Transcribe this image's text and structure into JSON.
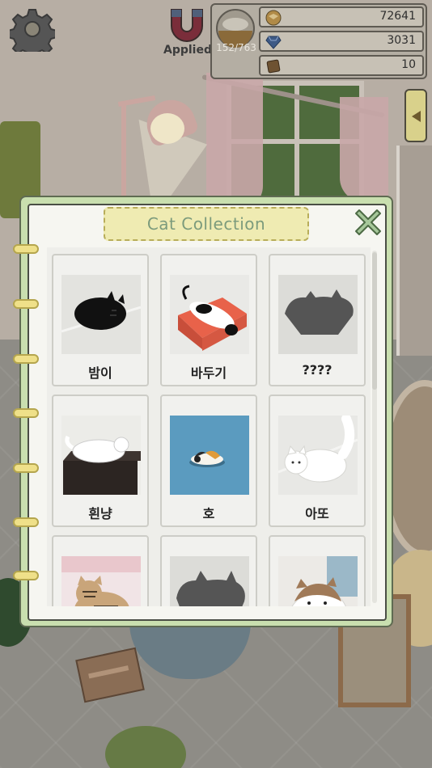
{
  "hud": {
    "magnet_status": "Applied",
    "meter_text": "152/763",
    "resources": [
      {
        "icon": "coin-icon",
        "value": "72641"
      },
      {
        "icon": "gem-icon",
        "value": "3031"
      },
      {
        "icon": "ticket-icon",
        "value": "10"
      }
    ]
  },
  "collection": {
    "title": "Cat Collection",
    "cats": [
      {
        "name": "밤이",
        "discovered": true,
        "photo": "black-cat-sleeping"
      },
      {
        "name": "바두기",
        "discovered": true,
        "photo": "tuxedo-cat-on-cushion"
      },
      {
        "name": "????",
        "discovered": false,
        "photo": "silhouette"
      },
      {
        "name": "흰냥",
        "discovered": true,
        "photo": "white-cat-on-cabinet"
      },
      {
        "name": "호",
        "discovered": true,
        "photo": "calico-cat-on-blue"
      },
      {
        "name": "아또",
        "discovered": true,
        "photo": "white-fluffy-cat-standing"
      },
      {
        "name": "",
        "discovered": true,
        "photo": "tabby-cat"
      },
      {
        "name": "",
        "discovered": false,
        "photo": "silhouette"
      },
      {
        "name": "",
        "discovered": true,
        "photo": "brown-white-cat"
      }
    ]
  },
  "colors": {
    "notebook_border": "#c9dfaf",
    "title_plate": "#efebb2",
    "title_text": "#7c9b7c",
    "ring": "#efe089"
  }
}
